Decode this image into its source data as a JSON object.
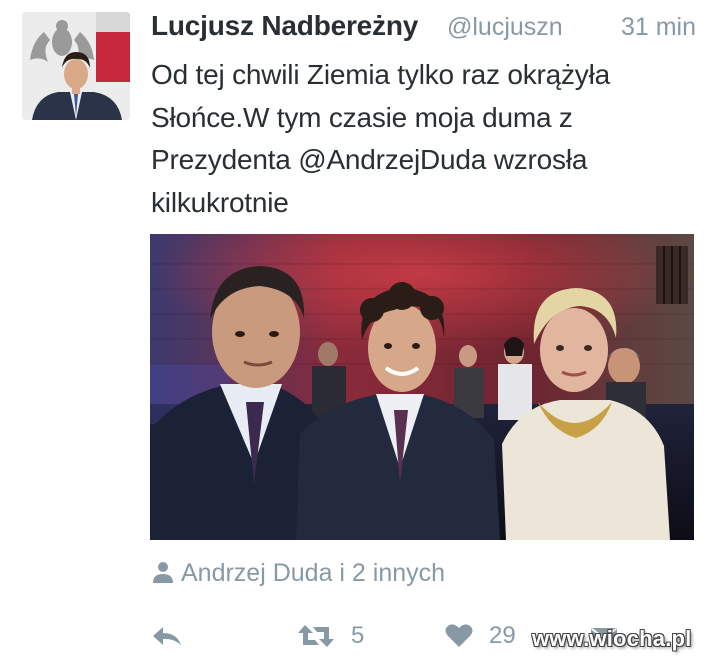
{
  "tweet": {
    "author": {
      "display_name": "Lucjusz Nadbereżny",
      "handle": "@lucjuszn",
      "avatar_icon": "profile-photo"
    },
    "timestamp": "31 min",
    "text_lines": [
      "Od tej chwili Ziemia tylko raz okrążyła",
      "Słońce.W tym czasie moja duma z",
      "Prezydenta @AndrzejDuda wzrosła",
      "kilkukrotnie"
    ],
    "media": {
      "icon": "photo"
    },
    "tagged": {
      "icon": "person-icon",
      "text": "Andrzej Duda i 2 innych"
    },
    "actions": {
      "reply_icon": "reply-icon",
      "retweet_icon": "retweet-icon",
      "retweet_count": "5",
      "like_icon": "heart-icon",
      "like_count": "29",
      "more_icon": "more-icon"
    }
  },
  "watermark": "www.wiocha.pl",
  "colors": {
    "text": "#292f33",
    "muted": "#8899a6",
    "background": "#ffffff"
  }
}
